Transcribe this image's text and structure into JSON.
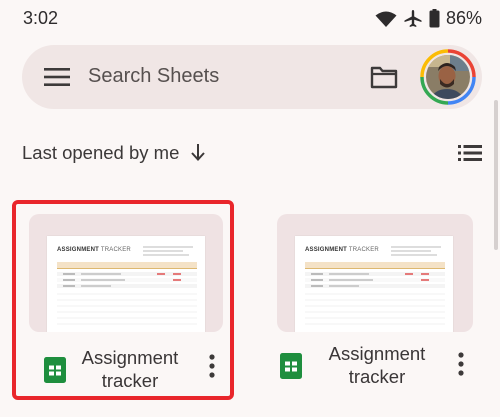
{
  "status_bar": {
    "time": "3:02",
    "battery": "86%",
    "icons": [
      "wifi-icon",
      "airplane-icon",
      "battery-icon"
    ]
  },
  "search": {
    "placeholder": "Search Sheets",
    "icons": [
      "menu-icon",
      "folder-icon",
      "avatar"
    ]
  },
  "sort": {
    "label": "Last opened by me",
    "icons": [
      "arrow-down-icon",
      "list-view-icon"
    ]
  },
  "files": [
    {
      "name_line1": "Assignment",
      "name_line2": "tracker",
      "selected": true,
      "preview_title_bold": "ASSIGNMENT",
      "preview_title_light": "TRACKER"
    },
    {
      "name_line1": "Assignment",
      "name_line2": "tracker",
      "selected": false,
      "preview_title_bold": "ASSIGNMENT",
      "preview_title_light": "TRACKER"
    }
  ],
  "colors": {
    "background": "#fbf7f6",
    "search_bar": "#f0e6e5",
    "selection_border": "#e9262b",
    "sheets_green": "#1e8e3e"
  }
}
